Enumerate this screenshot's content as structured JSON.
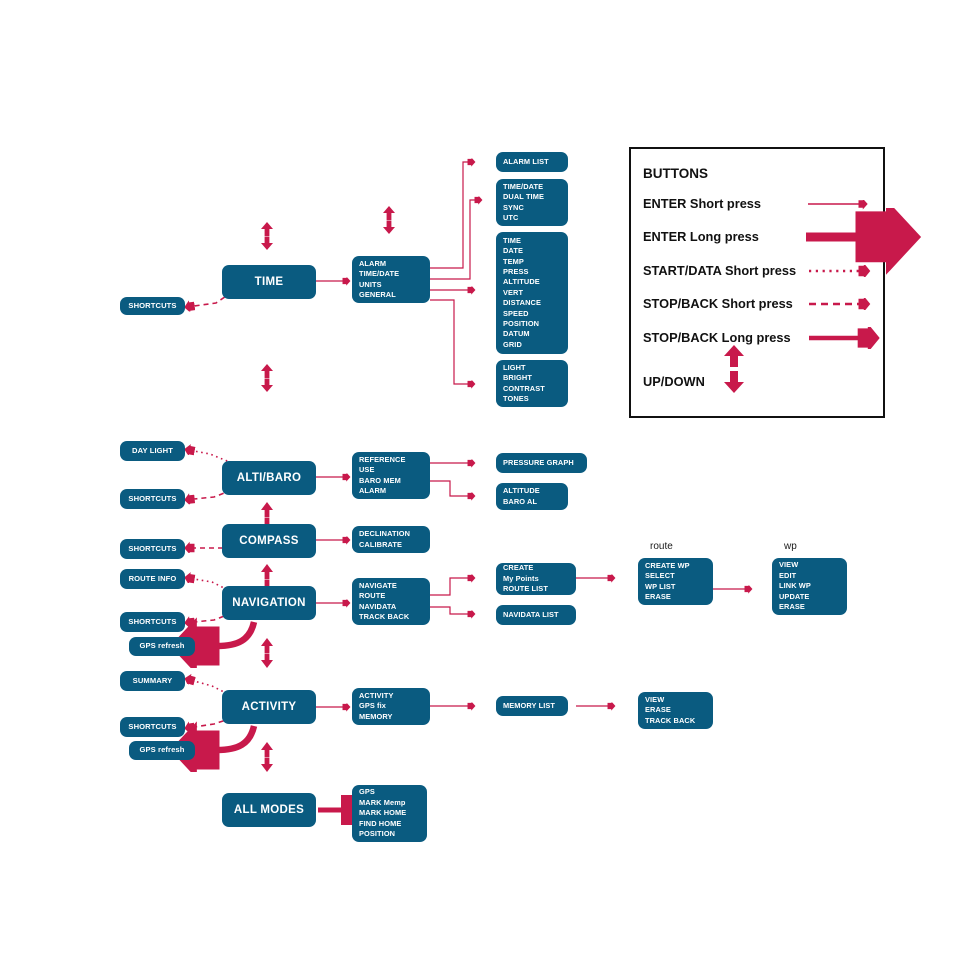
{
  "colors": {
    "node_fill": "#0a5b80",
    "arrow": "#c8194b",
    "text_on_node": "#ffffff",
    "legend_border": "#111111",
    "background": "#ffffff"
  },
  "legend": {
    "title": "BUTTONS",
    "rows": [
      {
        "label": "ENTER Short press",
        "style": "thin-solid-arrow"
      },
      {
        "label": "ENTER Long press",
        "style": "thick-solid-arrow"
      },
      {
        "label": "START/DATA Short press",
        "style": "dotted-arrow"
      },
      {
        "label": "STOP/BACK Short press",
        "style": "dashed-arrow"
      },
      {
        "label": "STOP/BACK Long press",
        "style": "medium-solid-arrow"
      },
      {
        "label": "UP/DOWN",
        "style": "up-down-arrows"
      }
    ]
  },
  "column_headers": [
    {
      "text": "route"
    },
    {
      "text": "wp"
    }
  ],
  "nodes": {
    "time_mode": {
      "lines": [
        "TIME"
      ]
    },
    "time_shortcuts": {
      "lines": [
        "SHORTCUTS"
      ]
    },
    "time_menu": {
      "lines": [
        "ALARM",
        "TIME/DATE",
        "UNITS",
        "GENERAL"
      ]
    },
    "alarm_list": {
      "lines": [
        "ALARM LIST"
      ]
    },
    "timedate_sub": {
      "lines": [
        "TIME/DATE",
        "DUAL TIME",
        "SYNC",
        "UTC"
      ]
    },
    "units_sub": {
      "lines": [
        "TIME",
        "DATE",
        "TEMP",
        "PRESS",
        "ALTITUDE",
        "VERT",
        "DISTANCE",
        "SPEED",
        "POSITION",
        "DATUM",
        "GRID"
      ]
    },
    "general_sub": {
      "lines": [
        "LIGHT",
        "BRIGHT",
        "CONTRAST",
        "TONES"
      ]
    },
    "day_light": {
      "lines": [
        "DAY LIGHT"
      ]
    },
    "alti_shortcuts": {
      "lines": [
        "SHORTCUTS"
      ]
    },
    "altibaro_mode": {
      "lines": [
        "ALTI/BARO"
      ]
    },
    "altibaro_menu": {
      "lines": [
        "REFERENCE",
        "USE",
        "BARO MEM",
        "ALARM"
      ]
    },
    "pressure_graph": {
      "lines": [
        "PRESSURE GRAPH"
      ]
    },
    "altitude_baroal": {
      "lines": [
        "ALTITUDE",
        "BARO AL"
      ]
    },
    "compass_shortcuts": {
      "lines": [
        "SHORTCUTS"
      ]
    },
    "compass_mode": {
      "lines": [
        "COMPASS"
      ]
    },
    "compass_menu": {
      "lines": [
        "DECLINATION",
        "CALIBRATE"
      ]
    },
    "route_info": {
      "lines": [
        "ROUTE INFO"
      ]
    },
    "nav_shortcuts": {
      "lines": [
        "SHORTCUTS"
      ]
    },
    "nav_gps_refresh": {
      "lines": [
        "GPS refresh"
      ]
    },
    "navigation_mode": {
      "lines": [
        "NAVIGATION"
      ]
    },
    "navigation_menu": {
      "lines": [
        "NAVIGATE",
        "ROUTE",
        "NAVIDATA",
        "TRACK BACK"
      ]
    },
    "route_menu": {
      "lines": [
        "CREATE",
        "My Points",
        "ROUTE LIST"
      ]
    },
    "navidata_list": {
      "lines": [
        "NAVIDATA LIST"
      ]
    },
    "route_col": {
      "lines": [
        "CREATE WP",
        "SELECT",
        "WP LIST",
        "ERASE"
      ]
    },
    "wp_col": {
      "lines": [
        "VIEW",
        "EDIT",
        "LINK WP",
        "UPDATE",
        "ERASE"
      ]
    },
    "summary": {
      "lines": [
        "SUMMARY"
      ]
    },
    "activity_shortcuts": {
      "lines": [
        "SHORTCUTS"
      ]
    },
    "activity_gps_refresh": {
      "lines": [
        "GPS refresh"
      ]
    },
    "activity_mode": {
      "lines": [
        "ACTIVITY"
      ]
    },
    "activity_menu": {
      "lines": [
        "ACTIVITY",
        "GPS fix",
        "MEMORY"
      ]
    },
    "memory_list": {
      "lines": [
        "MEMORY LIST"
      ]
    },
    "memory_sub": {
      "lines": [
        "VIEW",
        "ERASE",
        "TRACK BACK"
      ]
    },
    "all_modes": {
      "lines": [
        "ALL MODES"
      ]
    },
    "all_modes_menu": {
      "lines": [
        "GPS",
        "MARK Memp",
        "MARK HOME",
        "FIND HOME",
        "POSITION"
      ]
    }
  }
}
